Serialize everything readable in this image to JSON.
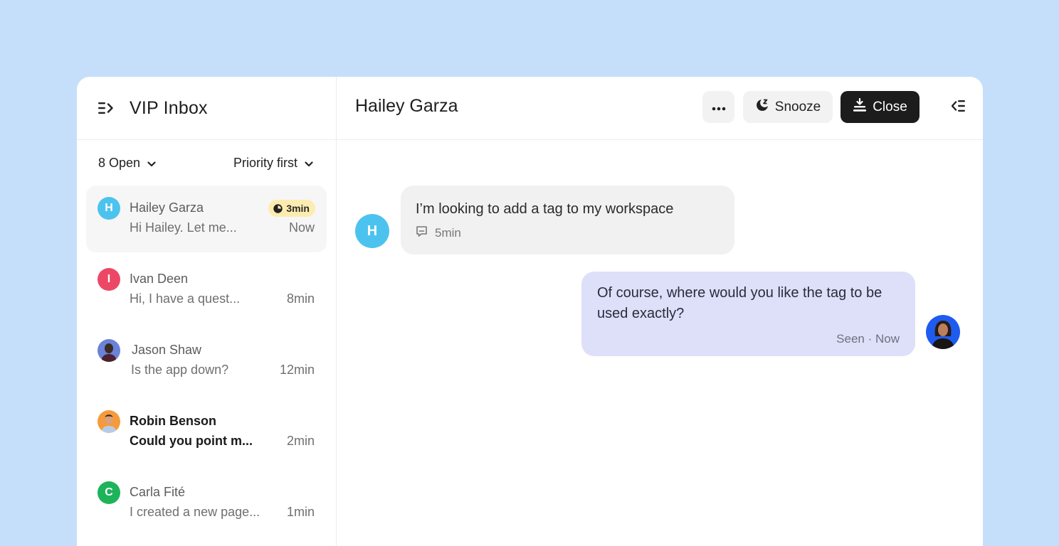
{
  "sidebar": {
    "title": "VIP Inbox",
    "toggle_icon": "collapse-left-icon",
    "filters": {
      "status_label": "8 Open",
      "sort_label": "Priority first"
    },
    "conversations": [
      {
        "name": "Hailey Garza",
        "initial": "H",
        "avatar_color": "#4cc3ee",
        "preview": "Hi Hailey. Let me...",
        "time": "Now",
        "badge": "3min",
        "active": true,
        "unread": false
      },
      {
        "name": "Ivan Deen",
        "initial": "I",
        "avatar_color": "#ec4866",
        "preview": "Hi, I have a quest...",
        "time": "8min",
        "active": false,
        "unread": false
      },
      {
        "name": "Jason Shaw",
        "initial": "",
        "avatar_color": "#6a82d8",
        "preview": "Is the app down?",
        "time": "12min",
        "active": false,
        "unread": false
      },
      {
        "name": "Robin Benson",
        "initial": "",
        "avatar_color": "#f59b3c",
        "preview": "Could you point m...",
        "time": "2min",
        "active": false,
        "unread": true
      },
      {
        "name": "Carla Fité",
        "initial": "C",
        "avatar_color": "#1db35a",
        "preview": "I created a new page...",
        "time": "1min",
        "active": false,
        "unread": false
      }
    ]
  },
  "conversation": {
    "title": "Hailey Garza",
    "actions": {
      "more_label": "more-options",
      "snooze_label": "Snooze",
      "close_label": "Close"
    },
    "messages": [
      {
        "direction": "incoming",
        "author_initial": "H",
        "author_color": "#4cc3ee",
        "text": "I’m looking to add a tag to my workspace",
        "meta": "5min"
      },
      {
        "direction": "outgoing",
        "text": "Of course, where would you like the tag to be used exactly?",
        "meta": "Seen · Now",
        "avatar_color": "#1e5cf0"
      }
    ]
  },
  "colors": {
    "background": "#c5dffb",
    "badge": "#fcecb0",
    "outgoing_bubble": "#dde0f8",
    "incoming_bubble": "#f1f1f1",
    "primary_button": "#1c1c1c"
  }
}
